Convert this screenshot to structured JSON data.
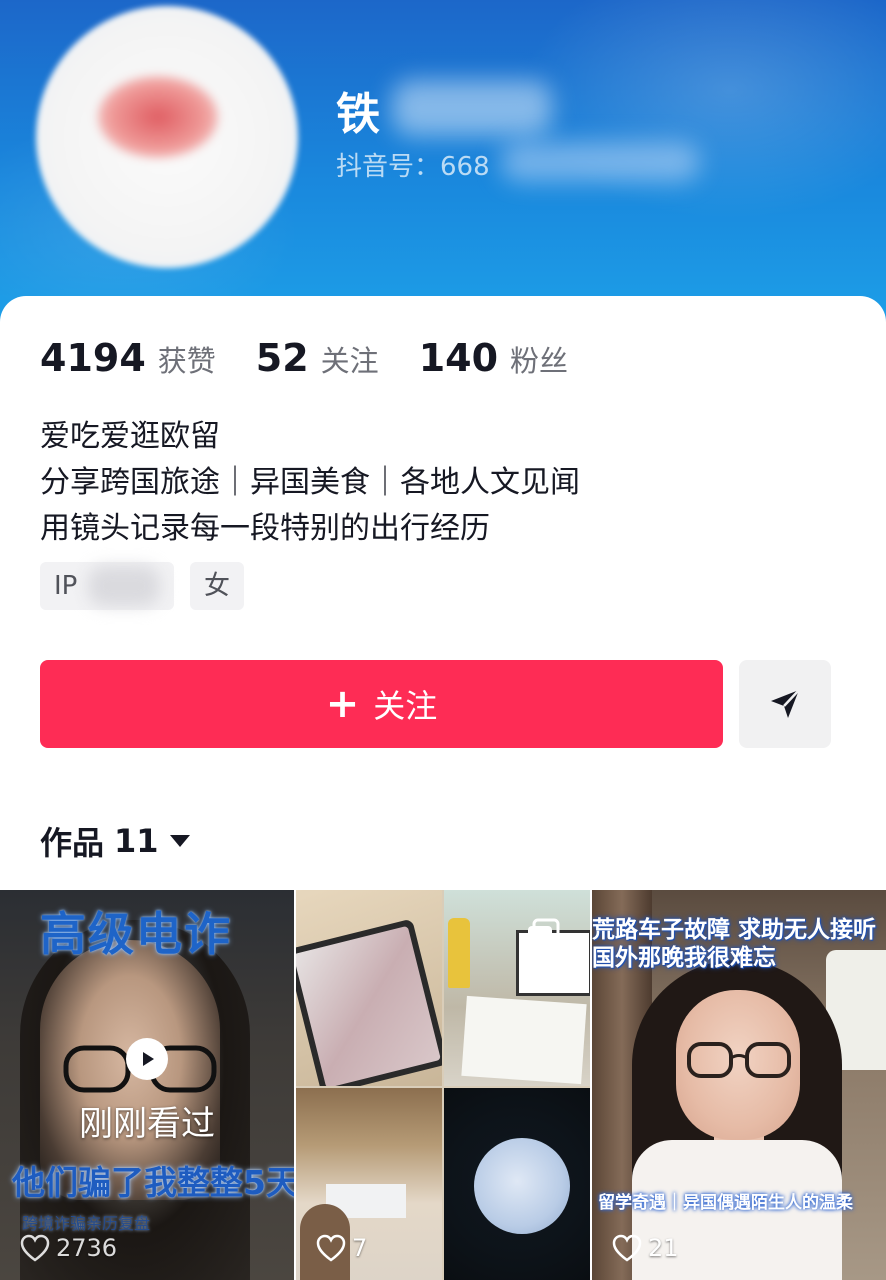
{
  "profile": {
    "name": "铁",
    "douyin_id_label": "抖音号：668"
  },
  "stats": [
    {
      "value": "4194",
      "label": "获赞"
    },
    {
      "value": "52",
      "label": "关注"
    },
    {
      "value": "140",
      "label": "粉丝"
    }
  ],
  "bio": [
    "爱吃爱逛欧留",
    "分享跨国旅途｜异国美食｜各地人文见闻",
    "用镜头记录每一段特别的出行经历"
  ],
  "tags": {
    "ip": "IP",
    "gender": "女"
  },
  "actions": {
    "follow_plus": "+",
    "follow_label": "关注",
    "share_icon": "send-arrow-icon"
  },
  "works": {
    "label": "作品",
    "count": "11"
  },
  "videos": [
    {
      "overlay_title": "高级电诈",
      "status": "刚刚看过",
      "caption": "他们骗了我整整5天!",
      "sub_caption": "跨境诈骗亲历复盘",
      "likes": "2736"
    },
    {
      "likes": "7"
    },
    {
      "overlay_title_line1": "荒路车子故障 求助无人接听",
      "overlay_title_line2": "国外那晚我很难忘",
      "caption": "留学奇遇｜异国偶遇陌生人的温柔",
      "likes": "21"
    }
  ],
  "colors": {
    "header_blue": "#1a88dd",
    "follow_red": "#fe2c55",
    "text_primary": "#161823",
    "text_secondary": "#6e7078"
  }
}
